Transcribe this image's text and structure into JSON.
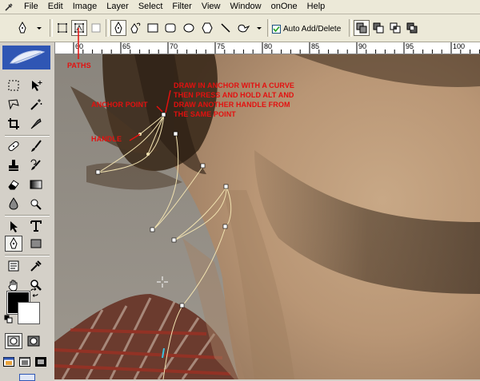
{
  "app": {
    "icon": "eye-dropper-app-icon"
  },
  "menu": {
    "items": [
      "File",
      "Edit",
      "Image",
      "Layer",
      "Select",
      "Filter",
      "View",
      "Window",
      "onOne",
      "Help"
    ]
  },
  "options": {
    "auto_add_label": "Auto Add/Delete",
    "auto_add_checked": true
  },
  "ruler": {
    "labels": [
      "60",
      "65",
      "70",
      "75",
      "80",
      "85",
      "90",
      "95",
      "100"
    ]
  },
  "annotations": {
    "paths": "PATHS",
    "anchor_point": "ANCHOR POINT",
    "handle": "HANDLE",
    "instruction_line1": "DRAW IN ANCHOR WITH A CURVE",
    "instruction_line2": "THEN PRESS AND HOLD ALT AND",
    "instruction_line3": "DRAW ANOTHER HANDLE FROM",
    "instruction_line4": "THE SAME POINT"
  },
  "colors": {
    "annotation": "#e4100f",
    "path_stroke": "#f1e2b0",
    "foreground": "#000000",
    "background": "#ffffff",
    "toolbox_header": "#2f56b4"
  }
}
